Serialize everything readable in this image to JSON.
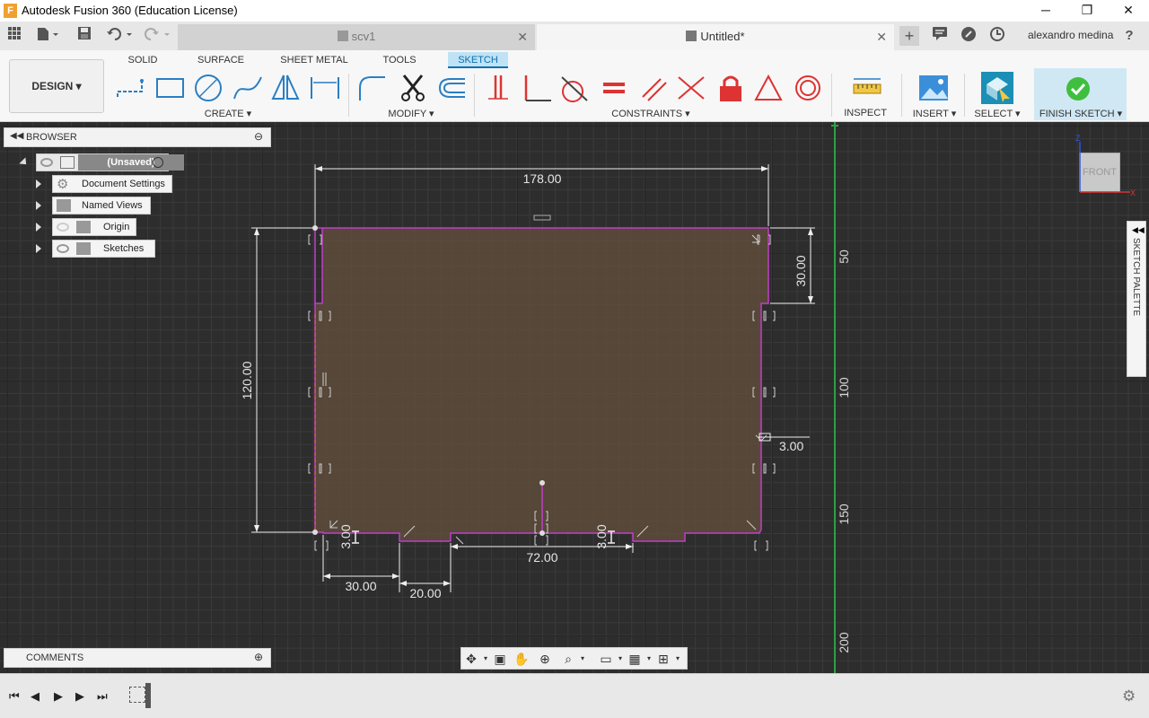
{
  "window": {
    "title": "Autodesk Fusion 360 (Education License)",
    "app_icon_letter": "F",
    "minimize": "─",
    "restore": "❐",
    "close": "✕"
  },
  "tabs": [
    {
      "label": "scv1",
      "close": "✕"
    },
    {
      "label": "Untitled*",
      "close": "✕"
    }
  ],
  "tabbar": {
    "new_tab": "+",
    "user": "alexandro medina",
    "help": "?"
  },
  "toolbar": {
    "workspace": "DESIGN",
    "tabs": [
      "SOLID",
      "SURFACE",
      "SHEET METAL",
      "TOOLS",
      "SKETCH"
    ],
    "active_tab": "SKETCH",
    "groups": {
      "create": "CREATE",
      "modify": "MODIFY",
      "constraints": "CONSTRAINTS",
      "inspect": "INSPECT",
      "insert": "INSERT",
      "select": "SELECT",
      "finish": "FINISH SKETCH"
    }
  },
  "browser": {
    "header": "BROWSER",
    "root": "(Unsaved)",
    "items": [
      "Document Settings",
      "Named Views",
      "Origin",
      "Sketches"
    ]
  },
  "comments": {
    "header": "COMMENTS"
  },
  "sketch_palette": {
    "label": "SKETCH PALETTE"
  },
  "viewcube": {
    "label": "FRONT",
    "z": "Z",
    "x": "X"
  },
  "sketch": {
    "dimensions": {
      "width": "178.00",
      "height": "120.00",
      "top_notch": "30.00",
      "notch_depth": "3.00",
      "bottom_left_depth": "3.00",
      "bottom_mid_depth": "3.00",
      "bottom_left_offset": "30.00",
      "bottom_left_width": "20.00",
      "bottom_center_width": "72.00"
    },
    "axis_labels": [
      "50",
      "100",
      "150",
      "200"
    ]
  },
  "colors": {
    "sketch_fill": "#5a4a38",
    "sketch_line": "#c13ec7",
    "accent": "#0a6fb0",
    "finish_check": "#3fbf3f",
    "axis_green": "#2ea043"
  }
}
